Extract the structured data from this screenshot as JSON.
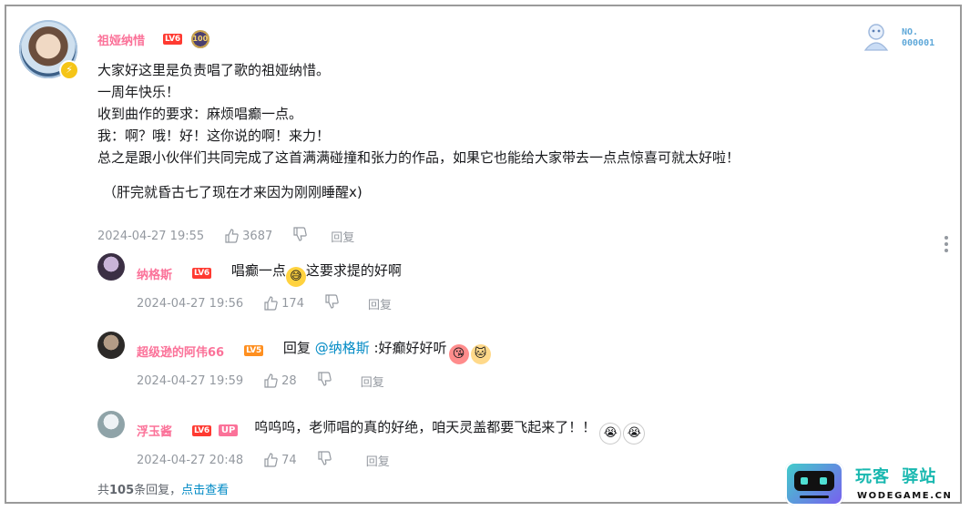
{
  "main_comment": {
    "username": "祖娅纳惜",
    "level": "LV6",
    "medal_text": "100",
    "fan_badge_line1": "NO.",
    "fan_badge_line2": "000001",
    "lines": [
      "大家好这里是负责唱了歌的祖娅纳惜。",
      "一周年快乐！",
      "收到曲作的要求：麻烦唱癫一点。",
      "我：啊？哦！好！这你说的啊！来力！",
      "总之是跟小伙伴们共同完成了这首满满碰撞和张力的作品，如果它也能给大家带去一点点惊喜可就太好啦！",
      "（肝完就昏古七了现在才来因为刚刚睡醒x)"
    ],
    "date": "2024-04-27 19:55",
    "likes": "3687",
    "reply_label": "回复",
    "more_icon": "more-vertical-icon"
  },
  "replies": [
    {
      "username": "纳格斯",
      "level": "LV6",
      "text_before": "唱癫一点",
      "text_after": "这要求提的好啊",
      "date": "2024-04-27 19:56",
      "likes": "174",
      "reply_label": "回复"
    },
    {
      "username": "超级逊的阿伟66",
      "level": "LV5",
      "reply_prefix": "回复 ",
      "at_user": "@纳格斯",
      "text": " :好癫好好听",
      "date": "2024-04-27 19:59",
      "likes": "28",
      "reply_label": "回复"
    },
    {
      "username": "浮玉酱",
      "level": "LV6",
      "up_tag": "UP",
      "text": "呜呜呜，老师唱的真的好绝，咱天灵盖都要飞起来了！！",
      "date": "2024-04-27 20:48",
      "likes": "74",
      "reply_label": "回复"
    }
  ],
  "footer": {
    "prefix": "共",
    "count": "105",
    "suffix": "条回复，",
    "view_link": "点击查看"
  },
  "watermark": {
    "cn_part1": "玩客",
    "cn_part2": "驿站",
    "en": "WODEGAME.CN"
  },
  "colors": {
    "username": "#fb7299",
    "link": "#008ac5",
    "meta": "#9499a0",
    "lv6": "#ff3a31",
    "lv5": "#ff8f1f"
  }
}
